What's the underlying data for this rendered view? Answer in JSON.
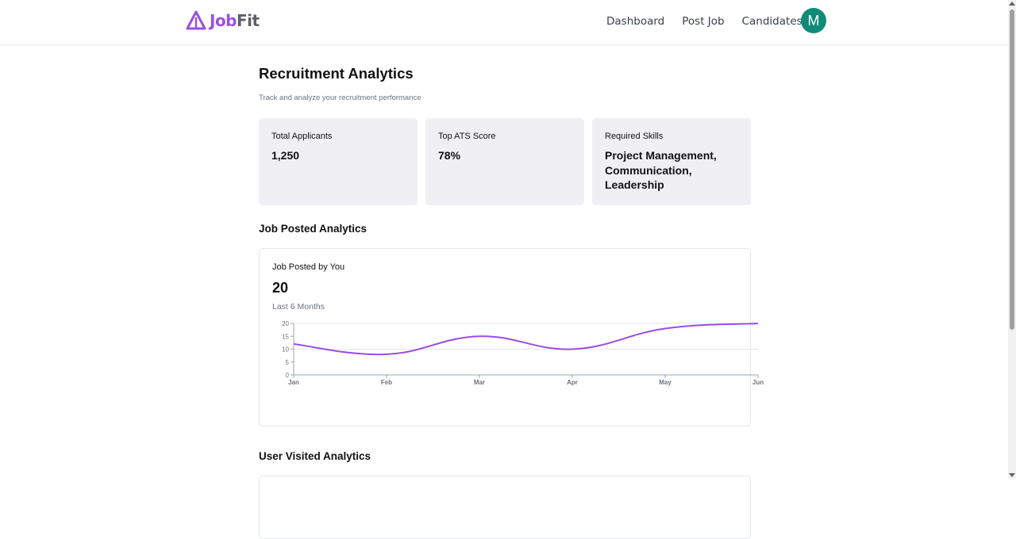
{
  "brand": {
    "name_part1": "Job",
    "name_part2": "Fit",
    "accent": "#9b51e0"
  },
  "nav": {
    "links": [
      "Dashboard",
      "Post Job",
      "Candidates"
    ],
    "avatar_initial": "M",
    "avatar_color": "#0f8b7a"
  },
  "page": {
    "title": "Recruitment Analytics",
    "subtitle": "Track and analyze your recruitment performance"
  },
  "stats": [
    {
      "label": "Total Applicants",
      "value": "1,250"
    },
    {
      "label": "Top ATS Score",
      "value": "78%"
    },
    {
      "label": "Required Skills",
      "value": "Project Management, Communication, Leadership"
    }
  ],
  "job_section": {
    "title": "Job Posted Analytics",
    "card_title": "Job Posted by You",
    "card_value": "20",
    "card_sub": "Last 6 Months"
  },
  "visits_section": {
    "title": "User Visited Analytics"
  },
  "chart_data": {
    "type": "line",
    "categories": [
      "Jan",
      "Feb",
      "Mar",
      "Apr",
      "May",
      "Jun"
    ],
    "series": [
      {
        "values": [
          12,
          8,
          15,
          10,
          18,
          20
        ],
        "color": "#9b4de0"
      }
    ],
    "yticks": [
      0,
      5,
      10,
      15,
      20
    ],
    "ylim": [
      0,
      20
    ],
    "grid": "horizontal",
    "legend": "none"
  }
}
